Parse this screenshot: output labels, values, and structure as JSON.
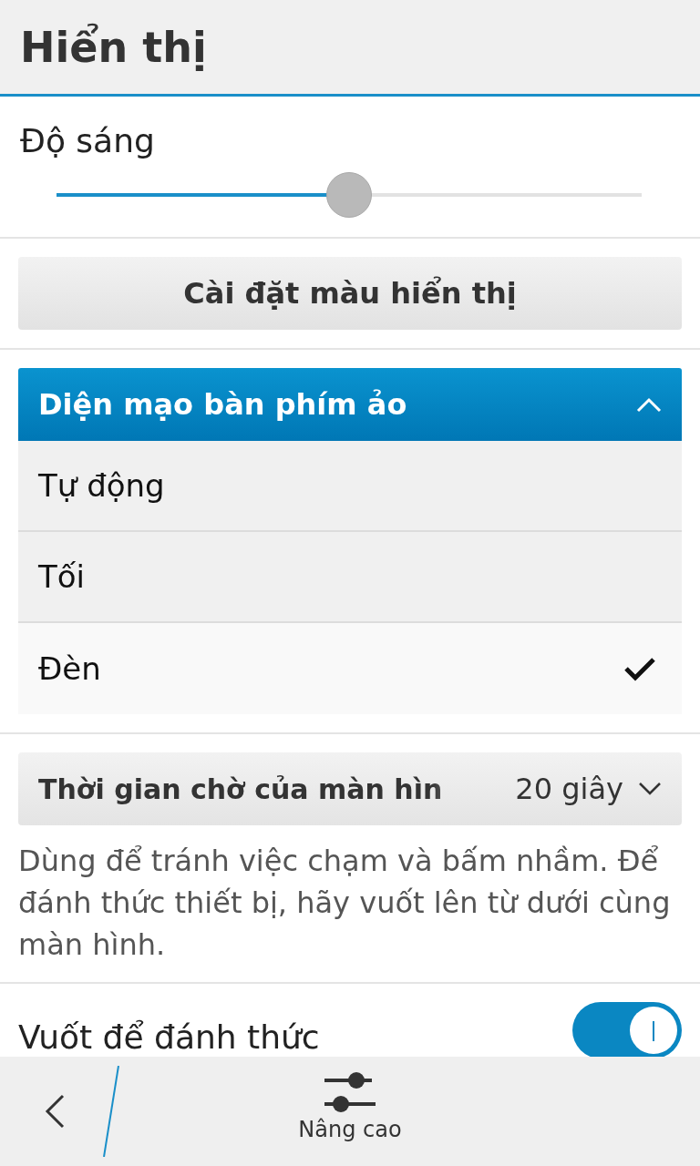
{
  "header": {
    "title": "Hiển thị"
  },
  "brightness": {
    "label": "Độ sáng",
    "level": 0.5
  },
  "color_button": {
    "label": "Cài đặt màu hiển thị"
  },
  "keyboard_theme": {
    "title": "Diện mạo bàn phím ảo",
    "expanded": true,
    "options": [
      {
        "label": "Tự động",
        "selected": false
      },
      {
        "label": "Tối",
        "selected": false
      },
      {
        "label": "Đèn",
        "selected": true
      }
    ]
  },
  "timeout": {
    "label": "Thời gian chờ của màn hìn",
    "value": "20 giây"
  },
  "description": "Dùng để tránh việc chạm và bấm nhầm. Để đánh thức thiết bị, hãy vuốt lên từ dưới cùng màn hình.",
  "wake": {
    "label": "Vuốt để đánh thức",
    "on": true
  },
  "bottom_bar": {
    "action": "Nâng cao"
  }
}
